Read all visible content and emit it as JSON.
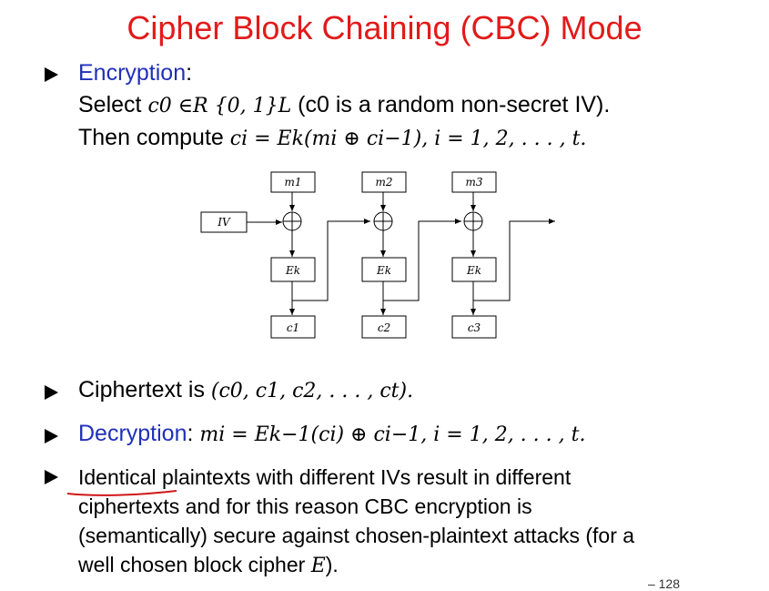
{
  "title": "Cipher Block Chaining (CBC) Mode",
  "encryption": {
    "label": "Encryption",
    "colon": ":",
    "select_word": "Select",
    "select_math": "c0 ∈R {0, 1}L",
    "select_note": "(c0 is a random non-secret IV).",
    "compute_word": "Then compute",
    "compute_math": "ci = Ek(mi ⊕ ci−1),   i = 1, 2, . . . , t."
  },
  "diagram": {
    "iv": "IV",
    "plaintexts": [
      "m1",
      "m2",
      "m3"
    ],
    "encrypt": [
      "Ek",
      "Ek",
      "Ek"
    ],
    "ciphertexts": [
      "c1",
      "c2",
      "c3"
    ]
  },
  "ciphertext_line": {
    "text": "Ciphertext is",
    "math": "(c0, c1, c2, . . . , ct)."
  },
  "decryption": {
    "label": "Decryption",
    "colon": ":",
    "math": "mi = Ek−1(ci) ⊕ ci−1,   i = 1, 2, . . . , t."
  },
  "identical": {
    "line1": "Identical plaintexts with different IVs result in different",
    "line2": "ciphertexts and for this reason CBC encryption is",
    "line3": "(semantically) secure against chosen-plaintext attacks (for a",
    "line4_a": "well chosen block cipher",
    "line4_math": "E",
    "line4_b": ")."
  },
  "page_number": "– 128"
}
